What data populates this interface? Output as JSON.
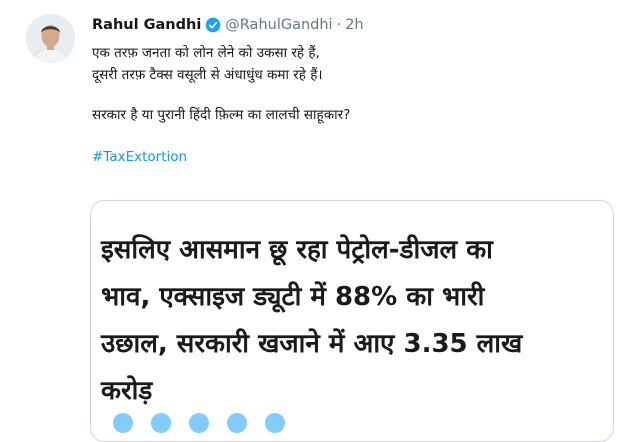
{
  "tweet": {
    "author_name": "Rahul Gandhi",
    "handle": "@RahulGandhi",
    "separator": "·",
    "time": "2h",
    "lines": [
      "एक तरफ़ जनता को लोन लेने को उकसा रहे हैं,",
      "दूसरी तरफ़ टैक्स वसूली से अंधाधुंध कमा रहे हैं।"
    ],
    "question": "सरकार है या पुरानी हिंदी फ़िल्म का लालची साहूकार?",
    "hashtag": "#TaxExtortion"
  },
  "card": {
    "headline_lines": [
      "इसलिए आसमान छू रहा पेट्रोल-डीजल का",
      "भाव, एक्साइज ड्यूटी में 88% का भारी",
      "उछाल, सरकारी खजाने में आए 3.35 लाख",
      "करोड़"
    ]
  },
  "icons": {
    "verified": "verified-badge-icon",
    "share": [
      "share-icon-1",
      "share-icon-2",
      "share-icon-3",
      "share-icon-4",
      "share-icon-5"
    ]
  },
  "colors": {
    "accent": "#1b95e0",
    "verified": "#1da1f2",
    "muted_text": "#657786",
    "card_border": "#ccd6dd"
  }
}
